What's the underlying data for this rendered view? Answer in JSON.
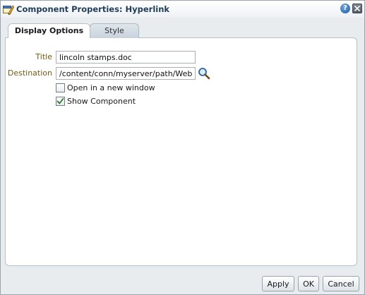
{
  "dialog": {
    "title": "Component Properties: Hyperlink",
    "help_icon_glyph": "?"
  },
  "tabs": [
    {
      "label": "Display Options",
      "selected": true
    },
    {
      "label": "Style",
      "selected": false
    }
  ],
  "fields": {
    "title": {
      "label": "Title",
      "value": "lincoln stamps.doc"
    },
    "destination": {
      "label": "Destination",
      "value": "/content/conn/myserver/path/WebCent"
    }
  },
  "options": {
    "open_new_window": {
      "label": "Open in a new window",
      "checked": false
    },
    "show_component": {
      "label": "Show Component",
      "checked": true
    }
  },
  "buttons": {
    "apply": "Apply",
    "ok": "OK",
    "cancel": "Cancel"
  },
  "colors": {
    "title_text": "#1f3d5c",
    "field_label": "#7a5a12",
    "check_mark": "#2b7a2b"
  }
}
